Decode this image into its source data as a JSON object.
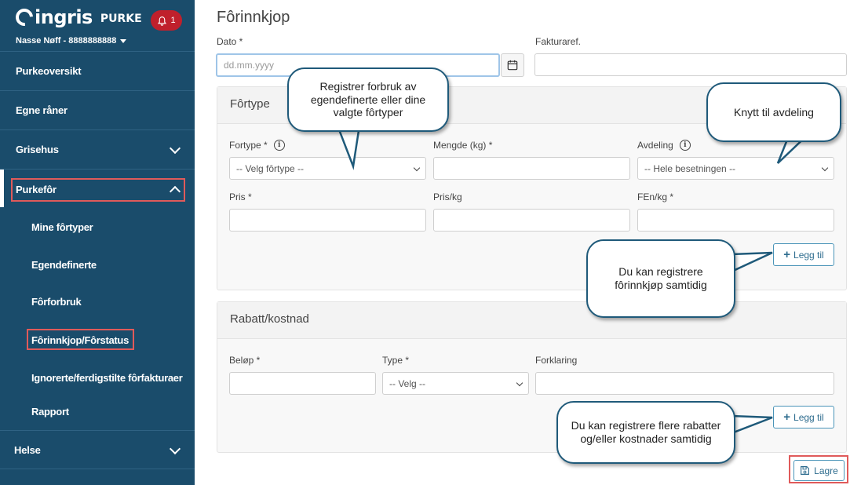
{
  "sidebar": {
    "logo": "ingris",
    "app_name": "PURKE",
    "notification_count": "1",
    "user": "Nasse Nøff - 8888888888",
    "items": [
      {
        "label": "Purkeoversikt"
      },
      {
        "label": "Egne råner"
      },
      {
        "label": "Grisehus"
      },
      {
        "label": "Purkefôr"
      },
      {
        "label": "Helse"
      }
    ],
    "subitems": [
      {
        "label": "Mine fôrtyper"
      },
      {
        "label": "Egendefinerte"
      },
      {
        "label": "Fôrforbruk"
      },
      {
        "label": "Fôrinnkjop/Fôrstatus"
      },
      {
        "label": "Ignorerte/ferdigstilte fôrfakturaer"
      },
      {
        "label": "Rapport"
      }
    ]
  },
  "main": {
    "title": "Fôrinnkjop",
    "dato_label": "Dato *",
    "dato_placeholder": "dd.mm.yyyy",
    "fakturaref_label": "Fakturaref.",
    "fortype_card": {
      "title": "Fôrtype",
      "fortype_label": "Fortype *",
      "fortype_value": "-- Velg fôrtype --",
      "mengde_label": "Mengde (kg) *",
      "avdeling_label": "Avdeling",
      "avdeling_value": "-- Hele besetningen --",
      "pris_label": "Pris *",
      "pris_kg_label": "Pris/kg",
      "fen_label": "FEn/kg *",
      "add_label": "Legg til"
    },
    "rabatt_card": {
      "title": "Rabatt/kostnad",
      "belop_label": "Beløp *",
      "type_label": "Type *",
      "type_value": "-- Velg --",
      "forklaring_label": "Forklaring",
      "add_label": "Legg til"
    },
    "save_label": "Lagre"
  },
  "callouts": {
    "fortyper": "Registrer forbruk av egendefinerte eller dine valgte fôrtyper",
    "avdeling": "Knytt til avdeling",
    "samtidig": "Du kan registrere fôrinnkjøp samtidig",
    "rabatter": "Du kan registrere flere rabatter og/eller kostnader samtidig"
  },
  "colors": {
    "sidebar_bg": "#1a4c6b",
    "badge": "#c0202c",
    "highlight": "#e05a5a",
    "accent": "#2f6d8f"
  }
}
